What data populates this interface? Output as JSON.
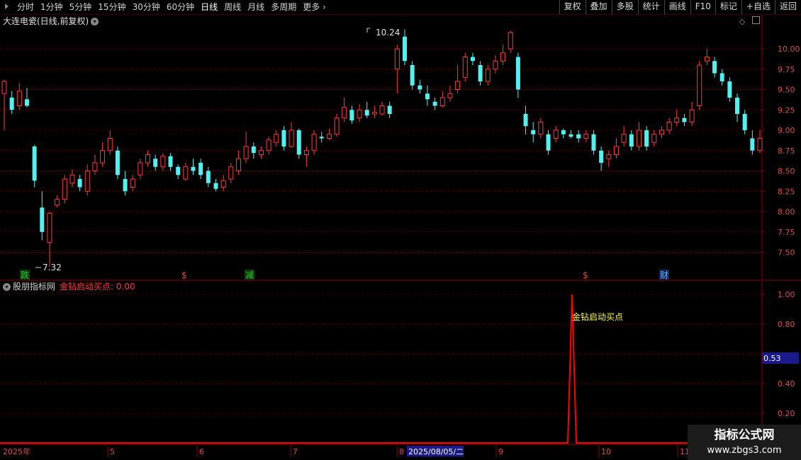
{
  "toolbar": {
    "periods": [
      "分时",
      "1分钟",
      "5分钟",
      "15分钟",
      "30分钟",
      "60分钟",
      "日线",
      "周线",
      "月线",
      "多周期",
      "更多"
    ],
    "active_period": "日线",
    "right_buttons": [
      "复权",
      "叠加",
      "多股",
      "统计",
      "画线",
      "F10",
      "标记",
      "+自选",
      "返回"
    ]
  },
  "title": "大连电瓷(日线,前复权)",
  "price_axis": [
    "10.00",
    "9.75",
    "9.50",
    "9.25",
    "9.00",
    "8.75",
    "8.50",
    "8.25",
    "8.00",
    "7.75",
    "7.50"
  ],
  "price_high_label": "10.24",
  "price_low_label": "7.32",
  "event_markers": [
    {
      "text": "跌",
      "color": "#27c41e",
      "bg": "#0b3a0b"
    },
    {
      "text": "$",
      "color": "#ff3a3a",
      "bg": "#000"
    },
    {
      "text": "减",
      "color": "#27c41e",
      "bg": "#0b3a0b"
    },
    {
      "text": "$",
      "color": "#ff3a3a",
      "bg": "#000"
    },
    {
      "text": "财",
      "color": "#6aa8ff",
      "bg": "#102a55"
    }
  ],
  "indicator": {
    "source": "股朋指标网",
    "name_value": "金钻启动买点: 0.00",
    "signal_label": "金钻启动买点",
    "axis": [
      "1.00",
      "0.80",
      "0.40",
      "0.20"
    ],
    "current_value": "0.53"
  },
  "date_axis": [
    "2025年",
    "5",
    "6",
    "7",
    "8",
    "9",
    "10",
    "11"
  ],
  "date_cursor": "2025/08/05/二",
  "watermark": {
    "line1": "指标公式网",
    "line2": "www.zbgs3.com"
  },
  "colors": {
    "up": "#ff3b3b",
    "down": "#54f0f0",
    "grid": "#7a0000",
    "signal": "#ff0000"
  },
  "chart_data": {
    "type": "candlestick",
    "ylim": [
      7.3,
      10.3
    ],
    "high": 10.24,
    "low": 7.32,
    "candles": [
      [
        9.45,
        9.6,
        9.62,
        9.0
      ],
      [
        9.4,
        9.25,
        9.48,
        9.2
      ],
      [
        9.3,
        9.48,
        9.58,
        9.25
      ],
      [
        9.38,
        9.3,
        9.52,
        9.28
      ],
      [
        8.8,
        8.38,
        8.82,
        8.3
      ],
      [
        8.05,
        7.75,
        8.25,
        7.65
      ],
      [
        7.62,
        7.98,
        8.0,
        7.32
      ],
      [
        8.08,
        8.15,
        8.2,
        8.05
      ],
      [
        8.15,
        8.4,
        8.45,
        8.1
      ],
      [
        8.35,
        8.45,
        8.52,
        8.3
      ],
      [
        8.4,
        8.3,
        8.45,
        8.25
      ],
      [
        8.25,
        8.5,
        8.58,
        8.2
      ],
      [
        8.5,
        8.6,
        8.7,
        8.45
      ],
      [
        8.6,
        8.75,
        8.85,
        8.55
      ],
      [
        8.75,
        8.9,
        9.0,
        8.7
      ],
      [
        8.75,
        8.45,
        8.8,
        8.4
      ],
      [
        8.4,
        8.25,
        8.5,
        8.2
      ],
      [
        8.3,
        8.4,
        8.45,
        8.25
      ],
      [
        8.45,
        8.6,
        8.65,
        8.4
      ],
      [
        8.6,
        8.7,
        8.75,
        8.55
      ],
      [
        8.65,
        8.55,
        8.7,
        8.5
      ],
      [
        8.55,
        8.68,
        8.72,
        8.5
      ],
      [
        8.68,
        8.55,
        8.72,
        8.5
      ],
      [
        8.55,
        8.45,
        8.58,
        8.4
      ],
      [
        8.4,
        8.55,
        8.6,
        8.38
      ],
      [
        8.55,
        8.5,
        8.65,
        8.45
      ],
      [
        8.6,
        8.45,
        8.65,
        8.4
      ],
      [
        8.5,
        8.35,
        8.55,
        8.3
      ],
      [
        8.35,
        8.28,
        8.4,
        8.25
      ],
      [
        8.3,
        8.38,
        8.45,
        8.25
      ],
      [
        8.4,
        8.55,
        8.6,
        8.35
      ],
      [
        8.5,
        8.65,
        8.75,
        8.45
      ],
      [
        8.65,
        8.8,
        8.98,
        8.6
      ],
      [
        8.8,
        8.72,
        8.85,
        8.65
      ],
      [
        8.7,
        8.75,
        8.8,
        8.65
      ],
      [
        8.75,
        8.88,
        8.92,
        8.7
      ],
      [
        8.85,
        8.95,
        9.0,
        8.8
      ],
      [
        9.0,
        8.8,
        9.05,
        8.75
      ],
      [
        8.8,
        9.0,
        9.1,
        8.78
      ],
      [
        9.0,
        8.7,
        9.02,
        8.65
      ],
      [
        8.7,
        8.75,
        8.8,
        8.55
      ],
      [
        8.75,
        8.95,
        9.0,
        8.7
      ],
      [
        8.92,
        8.9,
        8.98,
        8.85
      ],
      [
        8.9,
        8.95,
        9.02,
        8.88
      ],
      [
        8.95,
        9.15,
        9.2,
        8.92
      ],
      [
        9.15,
        9.28,
        9.4,
        9.1
      ],
      [
        9.25,
        9.12,
        9.3,
        9.08
      ],
      [
        9.15,
        9.25,
        9.32,
        9.1
      ],
      [
        9.25,
        9.18,
        9.35,
        9.15
      ],
      [
        9.2,
        9.22,
        9.3,
        9.15
      ],
      [
        9.2,
        9.3,
        9.35,
        9.18
      ],
      [
        9.3,
        9.2,
        9.35,
        9.15
      ],
      [
        9.75,
        10.0,
        10.05,
        9.45
      ],
      [
        10.15,
        9.85,
        10.24,
        9.8
      ],
      [
        9.8,
        9.55,
        9.85,
        9.5
      ],
      [
        9.55,
        9.5,
        9.62,
        9.45
      ],
      [
        9.45,
        9.38,
        9.55,
        9.3
      ],
      [
        9.35,
        9.3,
        9.4,
        9.25
      ],
      [
        9.3,
        9.4,
        9.48,
        9.28
      ],
      [
        9.4,
        9.45,
        9.55,
        9.35
      ],
      [
        9.5,
        9.6,
        9.8,
        9.45
      ],
      [
        9.65,
        9.9,
        9.95,
        9.6
      ],
      [
        9.9,
        9.85,
        9.95,
        9.8
      ],
      [
        9.8,
        9.6,
        9.85,
        9.55
      ],
      [
        9.6,
        9.75,
        9.8,
        9.55
      ],
      [
        9.75,
        9.85,
        9.92,
        9.7
      ],
      [
        9.85,
        9.95,
        10.05,
        9.8
      ],
      [
        10.0,
        10.2,
        10.22,
        9.95
      ],
      [
        9.9,
        9.5,
        9.95,
        9.4
      ],
      [
        9.2,
        9.05,
        9.3,
        8.95
      ],
      [
        9.0,
        8.95,
        9.1,
        8.85
      ],
      [
        8.95,
        9.1,
        9.15,
        8.9
      ],
      [
        8.95,
        8.75,
        9.0,
        8.7
      ],
      [
        8.9,
        9.0,
        9.05,
        8.85
      ],
      [
        9.0,
        8.95,
        9.02,
        8.9
      ],
      [
        8.95,
        8.92,
        9.0,
        8.9
      ],
      [
        8.95,
        8.9,
        9.0,
        8.85
      ],
      [
        8.9,
        8.95,
        9.0,
        8.85
      ],
      [
        8.95,
        8.75,
        9.0,
        8.7
      ],
      [
        8.75,
        8.6,
        8.8,
        8.5
      ],
      [
        8.65,
        8.7,
        8.75,
        8.55
      ],
      [
        8.7,
        8.8,
        8.9,
        8.65
      ],
      [
        8.85,
        8.95,
        9.05,
        8.8
      ],
      [
        8.95,
        8.8,
        9.0,
        8.75
      ],
      [
        8.8,
        9.0,
        9.1,
        8.75
      ],
      [
        9.0,
        8.8,
        9.05,
        8.75
      ],
      [
        8.85,
        8.95,
        9.0,
        8.8
      ],
      [
        8.95,
        9.0,
        9.05,
        8.9
      ],
      [
        9.0,
        9.1,
        9.15,
        8.95
      ],
      [
        9.1,
        9.15,
        9.25,
        9.05
      ],
      [
        9.15,
        9.1,
        9.2,
        9.05
      ],
      [
        9.1,
        9.25,
        9.35,
        9.05
      ],
      [
        9.3,
        9.8,
        9.85,
        9.25
      ],
      [
        9.85,
        9.9,
        10.0,
        9.8
      ],
      [
        9.85,
        9.7,
        9.9,
        9.65
      ],
      [
        9.7,
        9.6,
        9.75,
        9.55
      ],
      [
        9.6,
        9.4,
        9.65,
        9.35
      ],
      [
        9.4,
        9.2,
        9.45,
        9.1
      ],
      [
        9.2,
        9.0,
        9.25,
        8.95
      ],
      [
        8.9,
        8.75,
        9.0,
        8.7
      ],
      [
        8.75,
        8.9,
        9.0,
        8.72
      ]
    ],
    "indicator_series": {
      "name": "金钻启动买点",
      "ylim": [
        0,
        1.05
      ],
      "peak_value": 1.0
    }
  }
}
